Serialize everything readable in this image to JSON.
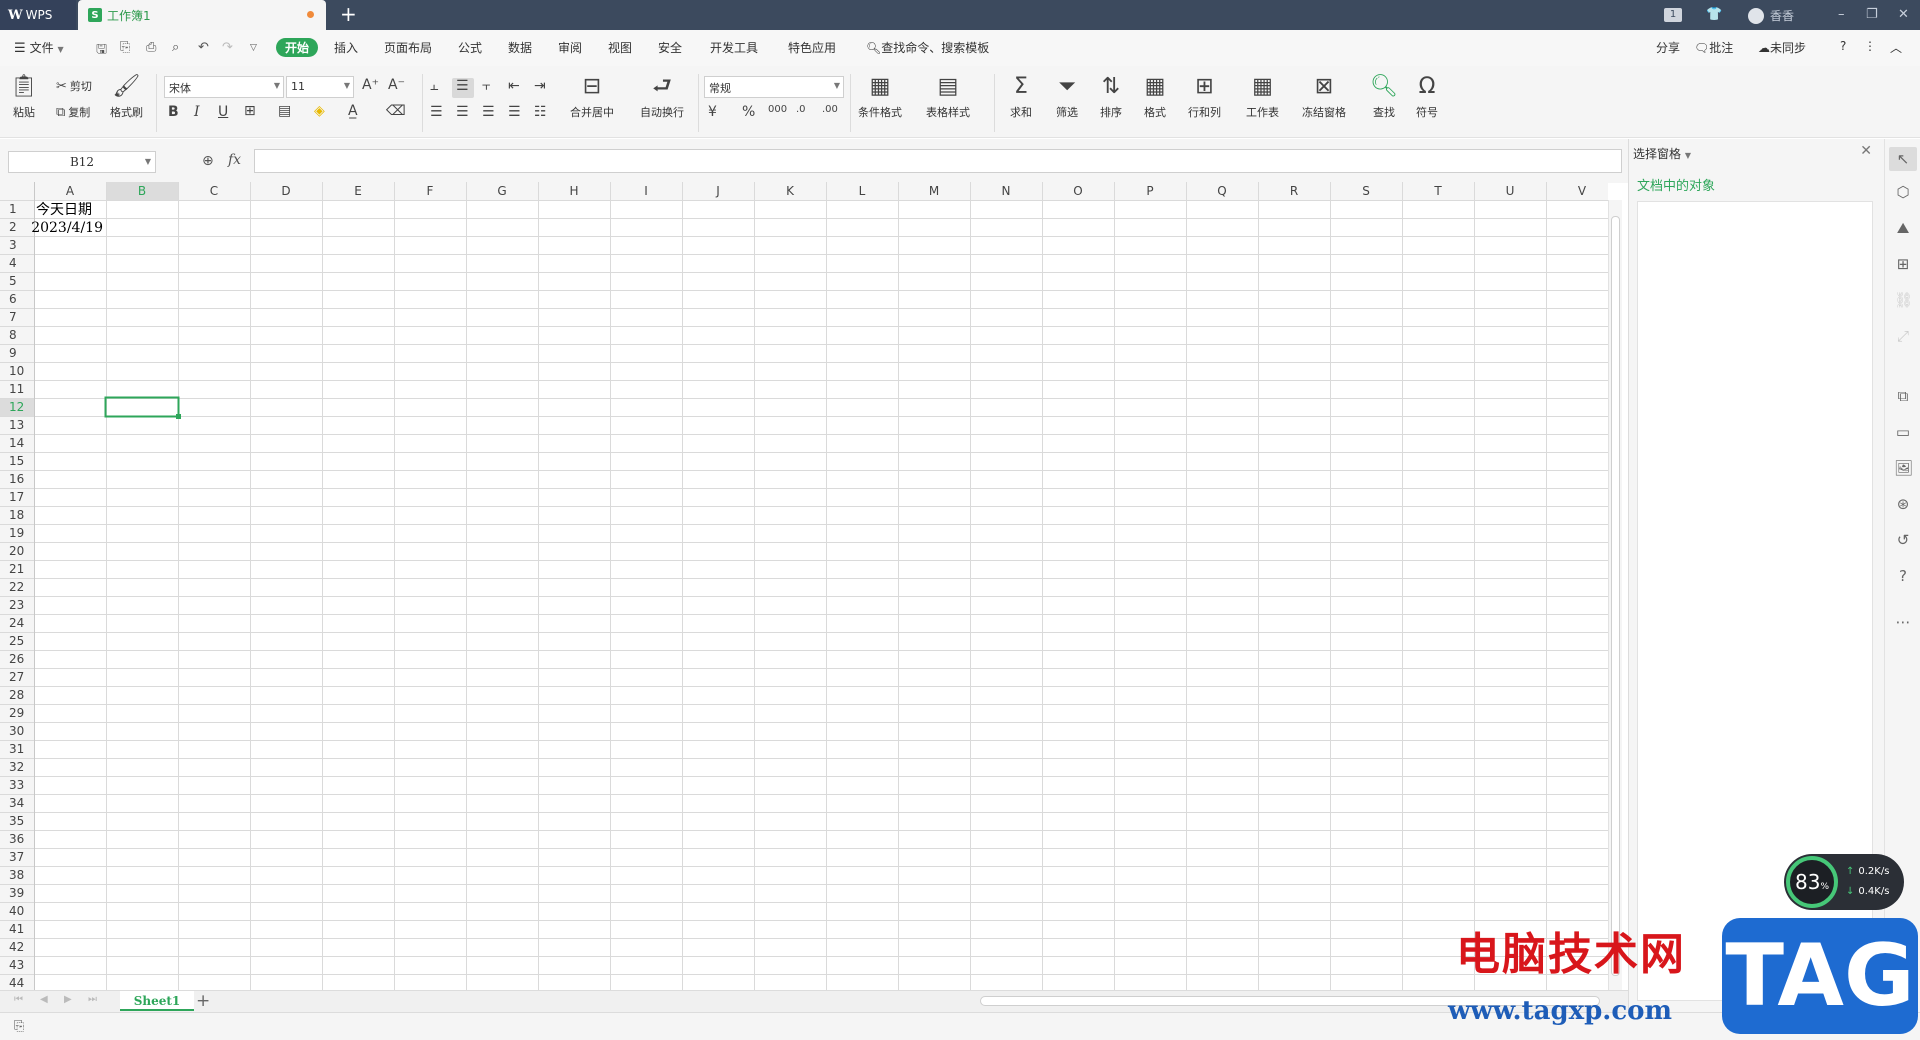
{
  "titlebar": {
    "app_label": "WPS",
    "doc_tab_label": "工作簿1",
    "doc_icon_letter": "S",
    "new_tab": "+",
    "badge": "1",
    "user_name": "香香",
    "min": "–",
    "max": "❐",
    "close": "✕"
  },
  "menubar": {
    "file": "文件",
    "start": "开始",
    "items": [
      "插入",
      "页面布局",
      "公式",
      "数据",
      "审阅",
      "视图",
      "安全",
      "开发工具",
      "特色应用"
    ],
    "search_cmd": "查找命令、搜索模板",
    "share": "分享",
    "comment": "批注",
    "sync": "未同步",
    "help": "?"
  },
  "ribbon": {
    "paste": "粘贴",
    "cut": "剪切",
    "copy": "复制",
    "format_painter": "格式刷",
    "font_name": "宋体",
    "font_size": "11",
    "merge_center": "合并居中",
    "auto_wrap": "自动换行",
    "number_format": "常规",
    "cond_format": "条件格式",
    "table_style": "表格样式",
    "sum": "求和",
    "filter": "筛选",
    "sort": "排序",
    "format": "格式",
    "rows_cols": "行和列",
    "worksheet": "工作表",
    "freeze": "冻结窗格",
    "find": "查找",
    "symbol": "符号"
  },
  "formula": {
    "name_box": "B12",
    "fx": "fx",
    "value": ""
  },
  "grid": {
    "columns": [
      "A",
      "B",
      "C",
      "D",
      "E",
      "F",
      "G",
      "H",
      "I",
      "J",
      "K",
      "L",
      "M",
      "N",
      "O",
      "P",
      "Q",
      "R",
      "S",
      "T",
      "U",
      "V"
    ],
    "row_count": 44,
    "selected_col": "B",
    "selected_row": 12,
    "cells": {
      "A1": "今天日期",
      "A2": "2023/4/19"
    },
    "grid_color": "#dadada",
    "selection_color": "#2ea65a"
  },
  "sheets": {
    "tabs": [
      "Sheet1"
    ],
    "add": "+"
  },
  "pane": {
    "title": "选择窗格",
    "subtitle": "文档中的对象",
    "close": "✕"
  },
  "watermark": {
    "brand": "电脑技术网",
    "url": "www.tagxp.com",
    "tag": "TAG"
  },
  "speed": {
    "percent": "83",
    "pct_sign": "%",
    "up": "0.2",
    "down": "0.4",
    "unit": "K/s"
  },
  "colors": {
    "accent": "#2ea65a",
    "titlebar": "#3c4a5e"
  }
}
